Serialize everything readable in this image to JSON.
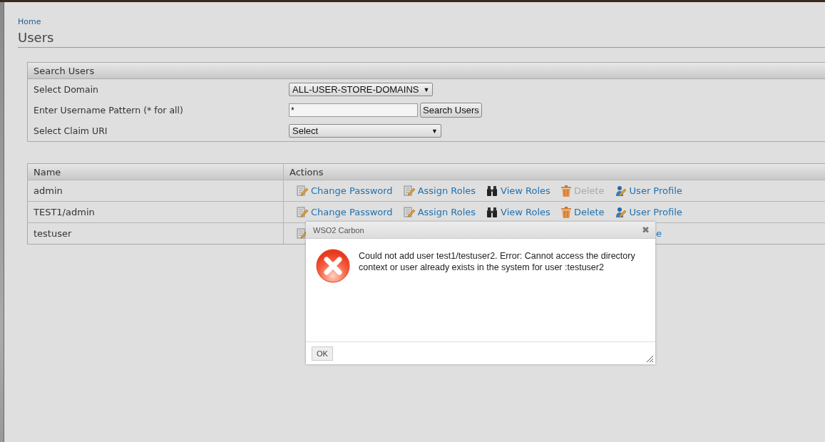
{
  "breadcrumb": "Home",
  "title": "Users",
  "search": {
    "header": "Search Users",
    "fields": [
      {
        "kind": "select",
        "label": "Select Domain",
        "value": "ALL-USER-STORE-DOMAINS",
        "arrow": "▼"
      },
      {
        "kind": "text",
        "label": "Enter Username Pattern (* for all)",
        "value": "*",
        "button": "Search Users"
      },
      {
        "kind": "select",
        "label": "Select Claim URI",
        "value": "Select",
        "arrow": "▼",
        "wide": true
      }
    ]
  },
  "table": {
    "columns": [
      "Name",
      "Actions"
    ],
    "rows": [
      {
        "name": "admin",
        "actions": [
          {
            "kind": "change-password",
            "label": "Change Password",
            "disabled": false
          },
          {
            "kind": "assign-roles",
            "label": "Assign Roles",
            "disabled": false
          },
          {
            "kind": "view-roles",
            "label": "View Roles",
            "disabled": false
          },
          {
            "kind": "delete",
            "label": "Delete",
            "disabled": true
          },
          {
            "kind": "user-profile",
            "label": "User Profile",
            "disabled": false
          }
        ]
      },
      {
        "name": "TEST1/admin",
        "actions": [
          {
            "kind": "change-password",
            "label": "Change Password",
            "disabled": false
          },
          {
            "kind": "assign-roles",
            "label": "Assign Roles",
            "disabled": false
          },
          {
            "kind": "view-roles",
            "label": "View Roles",
            "disabled": false
          },
          {
            "kind": "delete",
            "label": "Delete",
            "disabled": false
          },
          {
            "kind": "user-profile",
            "label": "User Profile",
            "disabled": false
          }
        ]
      },
      {
        "name": "testuser",
        "obscured": true,
        "actions": [
          {
            "kind": "change-password",
            "disabled": false
          },
          {
            "kind": "text",
            "label": "e",
            "disabled": false
          }
        ]
      }
    ]
  },
  "dialog": {
    "title": "WSO2 Carbon",
    "close": "✖",
    "message": "Could not add user test1/testuser2. Error: Cannot access the directory context or user already exists in the system for user :testuser2",
    "ok": "OK"
  }
}
